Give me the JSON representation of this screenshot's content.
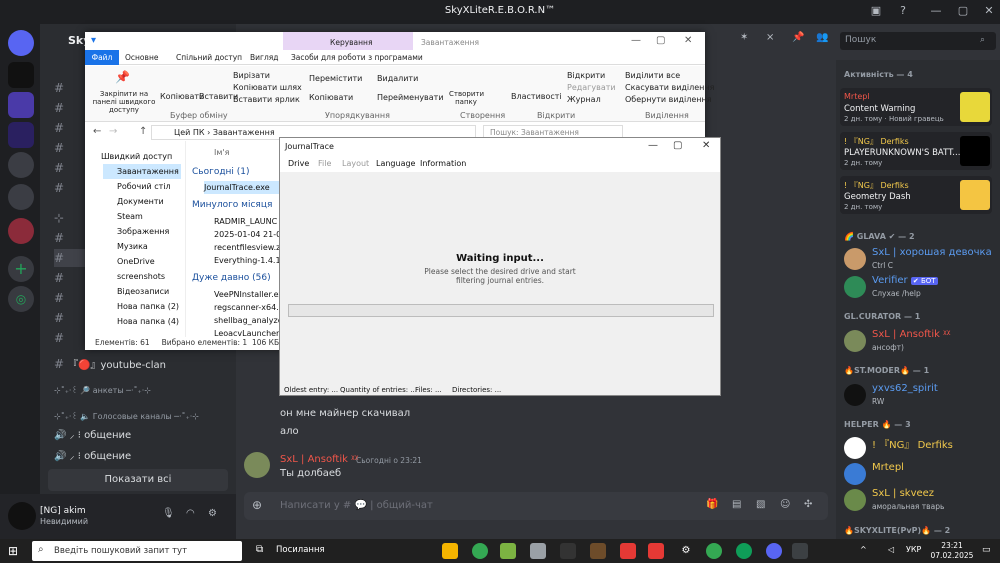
{
  "window_title": "SkyXLiteR.E.B.O.R.N™",
  "server_name": "Sky",
  "channels": [
    "",
    "",
    "",
    "",
    "",
    "",
    "",
    "",
    "",
    "",
    "",
    "",
    "",
    "",
    "",
    ""
  ],
  "channel_misc": {
    "youtube": "『🔴』youtube-clan",
    "ankety": "⊹˚₊·꒰ 🔎 анкеты ─·˚₊·⊹",
    "golos": "⊹˚₊·꒰ 🔈 Голосовые каналы ─·˚₊·⊹",
    "obsh1": "🔊 ⸝ ⁝ общение",
    "obsh2": "🔊 ⸝ ⁝ общение",
    "show_all": "Показати всі"
  },
  "user": {
    "name": "[NG] akim",
    "status": "Невидимий"
  },
  "chat": {
    "msg1": "он мне майнер скачивал",
    "msg2": "ало",
    "author": "SxL | Ansoftik ᵡᵡ",
    "time": "Сьогодні о 23:21",
    "msg3": "Ты долбаеб",
    "input_placeholder": "Написати у # 💬 | общий-чат"
  },
  "search": {
    "placeholder": "Пошук"
  },
  "members": {
    "online_header": "Активність — 4",
    "activity": [
      {
        "name": "Mrtepl",
        "game": "Content Warning",
        "meta": "2 дн. тому · Новий гравець"
      },
      {
        "name": "! 『NG』 Derfiks",
        "game": "PLAYERUNKNOWN'S BATT...",
        "meta": "2 дн. тому"
      },
      {
        "name": "! 『NG』 Derfiks",
        "game": "Geometry Dash",
        "meta": "2 дн. тому"
      }
    ],
    "glava_header": "🌈 GLAVA ✔ — 2",
    "glava": [
      {
        "name": "SxL | хорошая девочка",
        "status": "Ctrl C"
      },
      {
        "name": "Verifier",
        "badge": "✔ БОТ",
        "status": "Слухає /help"
      }
    ],
    "curator_header": "GL.CURATOR — 1",
    "curator": [
      {
        "name": "SxL | Ansoftik ᵡᵡ",
        "status": "ансофт)"
      }
    ],
    "moder_header": "🔥ST.MODER🔥 — 1",
    "moder": [
      {
        "name": "yxvs62_spirit",
        "status": "RW"
      }
    ],
    "helper_header": "HELPER 🔥 — 3",
    "helper": [
      {
        "name": "! 『NG』 Derfiks",
        "status": ""
      },
      {
        "name": "Mrtepl",
        "status": ""
      },
      {
        "name": "SxL | skveez",
        "status": "аморальная тварь"
      }
    ],
    "last_header": "🔥SKYXLITE(PvP)🔥 — 2"
  },
  "explorer": {
    "tabs": [
      "Файл",
      "Основне",
      "Спільний доступ",
      "Вигляд",
      "Засоби для роботи з програмами"
    ],
    "tab_manage": "Керування",
    "tab_download": "Завантаження",
    "ribbon": {
      "pin": "Закріпити на панелі швидкого доступу",
      "copy": "Копіювати",
      "paste": "Вставити",
      "cut": "Вирізати",
      "copy_path": "Копіювати шлях",
      "paste_link": "Вставити ярлик",
      "clipboard": "Буфер обміну",
      "move": "Перемістити",
      "copy_to": "Копіювати",
      "delete": "Видалити",
      "rename": "Перейменувати",
      "organize": "Упорядкування",
      "new_folder": "Створити папку",
      "create": "Створення",
      "props": "Властивості",
      "open": "Відкрити",
      "edit": "Редагувати",
      "journal": "Журнал",
      "open_group": "Відкрити",
      "sel_all": "Виділити все",
      "desel": "Скасувати виділення",
      "invert": "Обернути виділення",
      "select": "Виділення"
    },
    "path": "Цей ПК › Завантаження",
    "search_placeholder": "Пошук: Завантаження",
    "nav": [
      "Швидкий доступ",
      "Завантаження",
      "Робочий стіл",
      "Документи",
      "Steam",
      "Зображення",
      "Музика",
      "OneDrive",
      "screenshots",
      "Відеозаписи",
      "Нова папка (2)",
      "Нова папка (4)"
    ],
    "col_name": "Ім'я",
    "groups": [
      {
        "label": "Сьогодні (1)",
        "files": [
          "JournalTrace.exe"
        ]
      },
      {
        "label": "Минулого місяця",
        "files": [
          "RADMIR_LAUNC",
          "2025-01-04 21-0",
          "recentfilesview.z",
          "Everything-1.4.1."
        ]
      },
      {
        "label": "Дуже давно (56)",
        "files": [
          "VeePNInstaller.ex",
          "regscanner-x64.z",
          "shellbag_analyze",
          "LeoacvLauncher"
        ]
      }
    ],
    "status": "Елементів: 61     Вибрано елементів: 1  106 КБ"
  },
  "journal": {
    "title": "JournalTrace",
    "menu": [
      "Drive",
      "File",
      "Layout",
      "Language",
      "Information"
    ],
    "waiting": "Waiting input...",
    "hint": "Please select the desired drive and start filtering journal entries.",
    "status": [
      "Oldest entry: ...",
      "Quantity of entries: ...",
      "Files: ...",
      "Directories: ..."
    ]
  },
  "taskbar": {
    "search": "Введіть пошуковий запит тут",
    "app_label": "Посилання",
    "lang": "УКР",
    "time": "23:21",
    "date": "07.02.2025"
  }
}
